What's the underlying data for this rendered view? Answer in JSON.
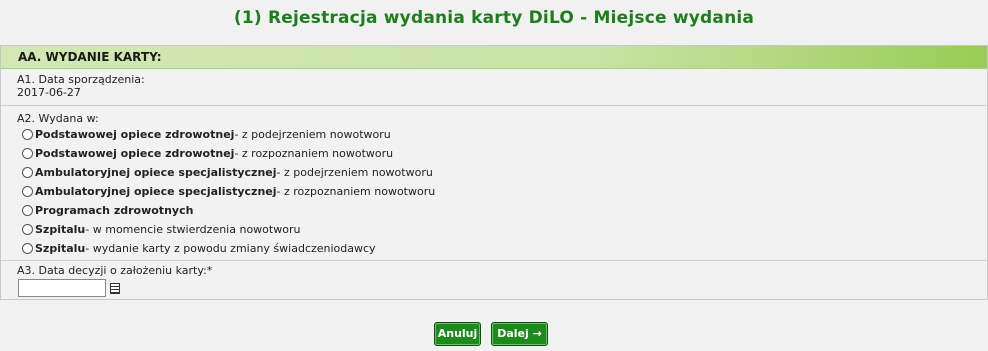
{
  "page": {
    "title": "(1) Rejestracja wydania karty DiLO - Miejsce wydania"
  },
  "section": {
    "header": "AA. WYDANIE KARTY:"
  },
  "a1": {
    "label": "A1. Data sporządzenia:",
    "value": "2017-06-27"
  },
  "a2": {
    "label": "A2. Wydana w:",
    "options": [
      {
        "bold": "Podstawowej opiece zdrowotnej",
        "desc": " - z podejrzeniem nowotworu"
      },
      {
        "bold": "Podstawowej opiece zdrowotnej",
        "desc": " - z rozpoznaniem nowotworu"
      },
      {
        "bold": "Ambulatoryjnej opiece specjalistycznej",
        "desc": " - z podejrzeniem nowotworu"
      },
      {
        "bold": "Ambulatoryjnej opiece specjalistycznej",
        "desc": " - z rozpoznaniem nowotworu"
      },
      {
        "bold": "Programach zdrowotnych",
        "desc": ""
      },
      {
        "bold": "Szpitalu",
        "desc": " - w momencie stwierdzenia nowotworu"
      },
      {
        "bold": "Szpitalu",
        "desc": " - wydanie karty z powodu zmiany świadczeniodawcy"
      }
    ]
  },
  "a3": {
    "label": "A3. Data decyzji o założeniu karty:*",
    "value": "",
    "calendar_icon": "calendar-icon"
  },
  "buttons": {
    "cancel": "Anuluj",
    "next": "Dalej →"
  }
}
